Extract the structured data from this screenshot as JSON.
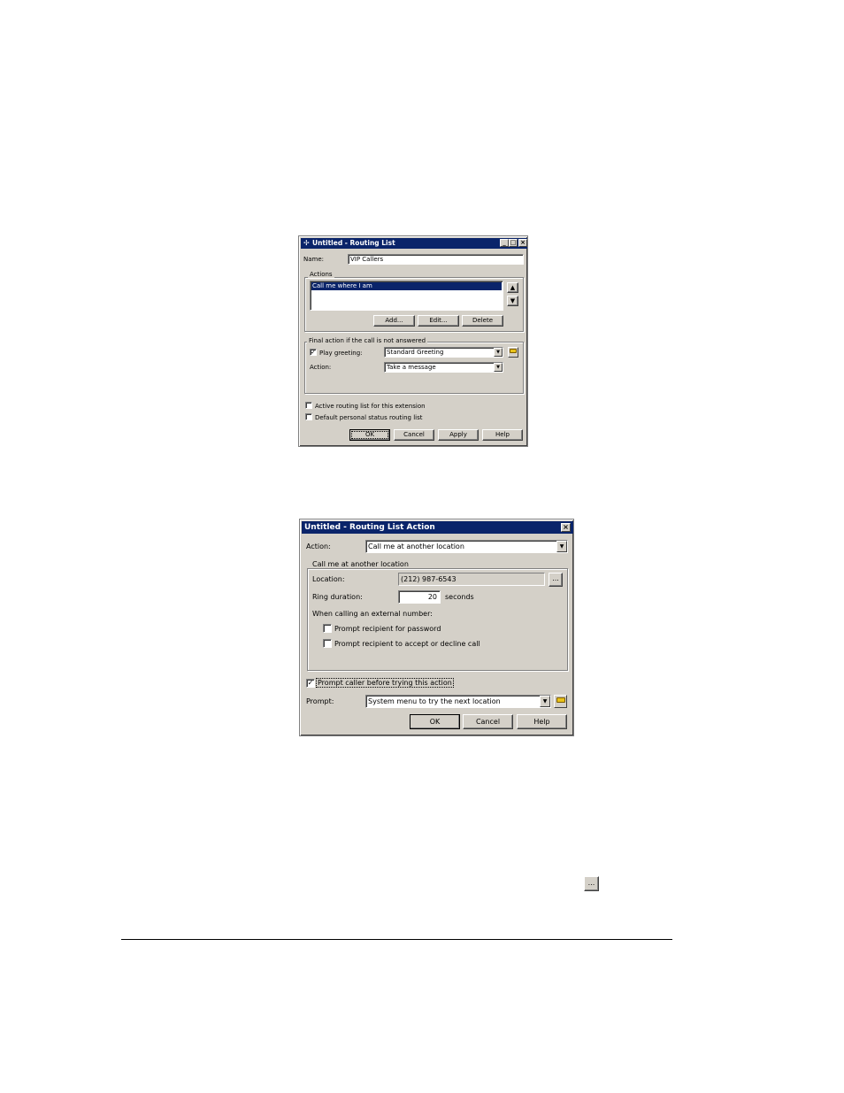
{
  "routing_list_dialog": {
    "title": "Untitled - Routing List",
    "name_label": "Name:",
    "name_value": "VIP Callers",
    "actions_group_label": "Actions",
    "actions_items": [
      "Call me where I am"
    ],
    "add_button": "Add...",
    "edit_button": "Edit...",
    "delete_button": "Delete",
    "final_action_group_label": "Final action if the call is not answered",
    "play_greeting_label": "Play greeting:",
    "play_greeting_checked": true,
    "greeting_value": "Standard Greeting",
    "action_label": "Action:",
    "action_value": "Take a message",
    "active_routing_label": "Active routing list for this extension",
    "default_status_label": "Default personal status routing list",
    "ok_button": "OK",
    "cancel_button": "Cancel",
    "apply_button": "Apply",
    "help_button": "Help"
  },
  "routing_action_dialog": {
    "title": "Untitled - Routing List Action",
    "action_label": "Action:",
    "action_value": "Call me at another location",
    "group_label": "Call me at another location",
    "location_label": "Location:",
    "location_value": "(212) 987-6543",
    "browse_button": "...",
    "ring_duration_label": "Ring duration:",
    "ring_duration_value": "20",
    "seconds_label": "seconds",
    "external_label": "When calling an external number:",
    "prompt_password_label": "Prompt recipient for password",
    "prompt_accept_label": "Prompt recipient to accept or decline call",
    "prompt_caller_label": "Prompt caller before trying this action",
    "prompt_caller_checked": true,
    "prompt_label": "Prompt:",
    "prompt_value": "System menu to try the next location",
    "ok_button": "OK",
    "cancel_button": "Cancel",
    "help_button": "Help"
  },
  "inline_browse_icon": "..."
}
